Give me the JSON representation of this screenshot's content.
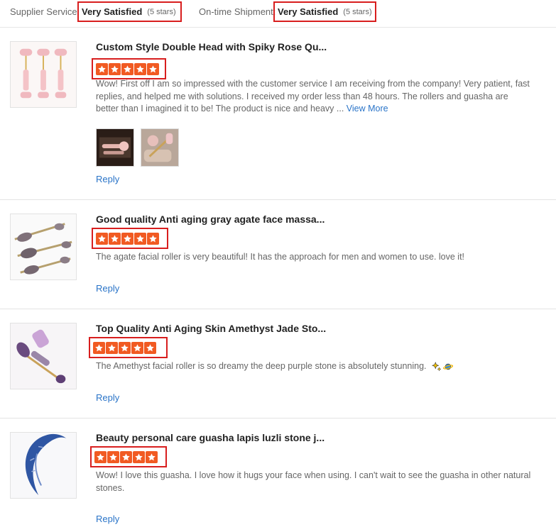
{
  "summary": {
    "supplier_service_label": "Supplier Service:",
    "supplier_service_value": "Very Satisfied",
    "supplier_service_stars": "(5 stars)",
    "shipment_label": "On-time Shipment:",
    "shipment_value": "Very Satisfied",
    "shipment_stars": "(5 stars)"
  },
  "reviews": [
    {
      "title": "Custom Style Double Head with Spiky Rose Qu...",
      "rating": 5,
      "text": "Wow! First off I am so impressed with the customer service I am receiving from the company! Very patient, fast replies, and helped me with solutions. I received my order less than 48 hours. The rollers and guasha are better than I imagined it to be! The product is nice and heavy ...",
      "view_more": "View More",
      "reply": "Reply"
    },
    {
      "title": "Good quality Anti aging gray agate face massa...",
      "rating": 5,
      "text": "The agate facial roller is very beautiful! It has the approach for men and women to use. love it!",
      "reply": "Reply"
    },
    {
      "title": "Top Quality Anti Aging Skin Amethyst Jade Sto...",
      "rating": 5,
      "text": "The Amethyst facial roller is so dreamy the deep purple stone is absolutely stunning.",
      "emojis": [
        "sparkle-icon",
        "planet-icon"
      ],
      "reply": "Reply"
    },
    {
      "title": "Beauty personal care guasha lapis luzli stone j...",
      "rating": 5,
      "text": "Wow! I love this guasha. I love how it hugs  your face when using. I can't wait to see the guasha in other natural stones.",
      "reply": "Reply"
    }
  ],
  "colors": {
    "accent": "#f15a22",
    "highlight_border": "#d81e1e",
    "link": "#2a74c8"
  }
}
